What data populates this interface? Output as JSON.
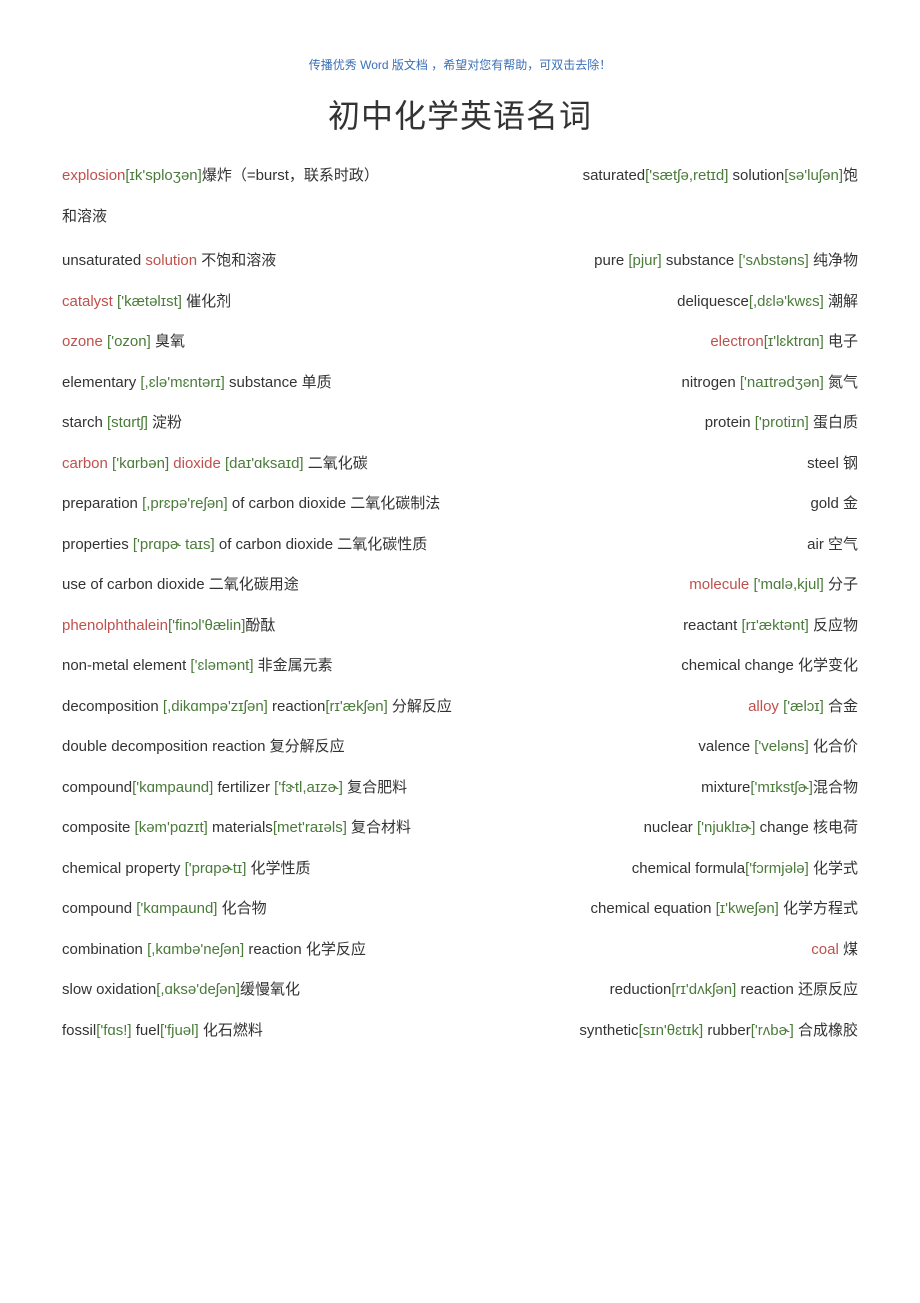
{
  "header_note": "传播优秀 Word 版文档 ，希望对您有帮助，可双击去除！",
  "title": "初中化学英语名词",
  "rows": [
    {
      "left": [
        {
          "t": "explosion",
          "c": "red"
        },
        {
          "t": "[ɪk'sploʒən]",
          "c": "grn"
        },
        {
          "t": "爆炸（=burst，联系时政）",
          "c": "blk"
        }
      ],
      "right": [
        {
          "t": "saturated",
          "c": "blk"
        },
        {
          "t": "['sætʃə,retɪd]",
          "c": "grn"
        },
        {
          "t": " solution",
          "c": "blk"
        },
        {
          "t": "[sə'luʃən]",
          "c": "grn"
        },
        {
          "t": "饱",
          "c": "blk"
        }
      ],
      "wrap": [
        {
          "t": "和溶液",
          "c": "blk"
        }
      ]
    },
    {
      "left": [
        {
          "t": "unsaturated ",
          "c": "blk"
        },
        {
          "t": "solution",
          "c": "red"
        },
        {
          "t": "  不饱和溶液",
          "c": "blk"
        }
      ],
      "right": [
        {
          "t": "pure ",
          "c": "blk"
        },
        {
          "t": "[pjur]",
          "c": "grn"
        },
        {
          "t": " substance ",
          "c": "blk"
        },
        {
          "t": "['sʌbstəns]",
          "c": "grn"
        },
        {
          "t": "  纯净物",
          "c": "blk"
        }
      ]
    },
    {
      "left": [
        {
          "t": "catalyst ",
          "c": "red"
        },
        {
          "t": "['kætəlɪst]",
          "c": "grn"
        },
        {
          "t": "  催化剂",
          "c": "blk"
        }
      ],
      "right": [
        {
          "t": "deliquesce",
          "c": "blk"
        },
        {
          "t": "[,dɛlə'kwɛs]",
          "c": "grn"
        },
        {
          "t": "    潮解",
          "c": "blk"
        }
      ]
    },
    {
      "left": [
        {
          "t": "ozone ",
          "c": "red"
        },
        {
          "t": "['ozon]",
          "c": "grn"
        },
        {
          "t": "  臭氧",
          "c": "blk"
        }
      ],
      "right": [
        {
          "t": "electron",
          "c": "red"
        },
        {
          "t": "[ɪ'lɛktrɑn]",
          "c": "grn"
        },
        {
          "t": "  电子",
          "c": "blk"
        }
      ]
    },
    {
      "left": [
        {
          "t": "elementary ",
          "c": "blk"
        },
        {
          "t": "[,ɛlə'mɛntərɪ]",
          "c": "grn"
        },
        {
          "t": " substance  单质",
          "c": "blk"
        }
      ],
      "right": [
        {
          "t": "nitrogen ",
          "c": "blk"
        },
        {
          "t": "['naɪtrədʒən]",
          "c": "grn"
        },
        {
          "t": "  氮气",
          "c": "blk"
        }
      ]
    },
    {
      "left": [
        {
          "t": "starch ",
          "c": "blk"
        },
        {
          "t": "[stɑrtʃ]",
          "c": "grn"
        },
        {
          "t": "  淀粉",
          "c": "blk"
        }
      ],
      "right": [
        {
          "t": "protein ",
          "c": "blk"
        },
        {
          "t": "['protiɪn]",
          "c": "grn"
        },
        {
          "t": "  蛋白质",
          "c": "blk"
        }
      ]
    },
    {
      "left": [
        {
          "t": "carbon ",
          "c": "red"
        },
        {
          "t": "['kɑrbən]",
          "c": "grn"
        },
        {
          "t": " dioxide ",
          "c": "red"
        },
        {
          "t": "[daɪ'ɑksaɪd]",
          "c": "grn"
        },
        {
          "t": "  二氧化碳",
          "c": "blk"
        }
      ],
      "right": [
        {
          "t": "steel  钢",
          "c": "blk"
        }
      ]
    },
    {
      "left": [
        {
          "t": "preparation ",
          "c": "blk"
        },
        {
          "t": "[,prɛpə'reʃən]",
          "c": "grn"
        },
        {
          "t": " of carbon dioxide  二氧化碳制法",
          "c": "blk"
        }
      ],
      "right": [
        {
          "t": "gold  金",
          "c": "blk"
        }
      ]
    },
    {
      "left": [
        {
          "t": "properties ",
          "c": "blk"
        },
        {
          "t": "['prɑpɚ taɪs]",
          "c": "grn"
        },
        {
          "t": " of carbon dioxide  二氧化碳性质",
          "c": "blk"
        }
      ],
      "right": [
        {
          "t": "air  空气",
          "c": "blk"
        }
      ]
    },
    {
      "left": [
        {
          "t": "use of carbon dioxide  二氧化碳用途",
          "c": "blk"
        }
      ],
      "right": [
        {
          "t": "molecule ",
          "c": "red"
        },
        {
          "t": "['mɑlə,kjul]",
          "c": "grn"
        },
        {
          "t": "  分子",
          "c": "blk"
        }
      ]
    },
    {
      "left": [
        {
          "t": "phenolphthalein",
          "c": "red"
        },
        {
          "t": "['finɔl'θælin]",
          "c": "grn"
        },
        {
          "t": "酚酞",
          "c": "blk"
        }
      ],
      "right": [
        {
          "t": "reactant ",
          "c": "blk"
        },
        {
          "t": "[rɪ'æktənt]",
          "c": "grn"
        },
        {
          "t": "  反应物",
          "c": "blk"
        }
      ]
    },
    {
      "left": [
        {
          "t": "non-metal element ",
          "c": "blk"
        },
        {
          "t": "['ɛləmənt]",
          "c": "grn"
        },
        {
          "t": "  非金属元素",
          "c": "blk"
        }
      ],
      "right": [
        {
          "t": "chemical change  化学变化",
          "c": "blk"
        }
      ]
    },
    {
      "left": [
        {
          "t": "decomposition ",
          "c": "blk"
        },
        {
          "t": "[,dikɑmpə'zɪʃən]",
          "c": "grn"
        },
        {
          "t": " reaction",
          "c": "blk"
        },
        {
          "t": "[rɪ'ækʃən]",
          "c": "grn"
        },
        {
          "t": "  分解反应",
          "c": "blk"
        }
      ],
      "right": [
        {
          "t": "alloy ",
          "c": "red"
        },
        {
          "t": "['ælɔɪ]",
          "c": "grn"
        },
        {
          "t": "  合金",
          "c": "blk"
        }
      ]
    },
    {
      "left": [
        {
          "t": "double decomposition reaction 复分解反应",
          "c": "blk"
        }
      ],
      "right": [
        {
          "t": "valence ",
          "c": "blk"
        },
        {
          "t": "['veləns]",
          "c": "grn"
        },
        {
          "t": "  化合价",
          "c": "blk"
        }
      ]
    },
    {
      "left": [
        {
          "t": "compound",
          "c": "blk"
        },
        {
          "t": "['kɑmpaund]",
          "c": "grn"
        },
        {
          "t": " fertilizer ",
          "c": "blk"
        },
        {
          "t": "['fɝtl,aɪzɚ]",
          "c": "grn"
        },
        {
          "t": "  复合肥料",
          "c": "blk"
        }
      ],
      "right": [
        {
          "t": "mixture",
          "c": "blk"
        },
        {
          "t": "['mɪkstʃɚ]",
          "c": "grn"
        },
        {
          "t": "混合物",
          "c": "blk"
        }
      ]
    },
    {
      "left": [
        {
          "t": "composite ",
          "c": "blk"
        },
        {
          "t": "[kəm'pɑzɪt]",
          "c": "grn"
        },
        {
          "t": " materials",
          "c": "blk"
        },
        {
          "t": "[met'raɪəls]",
          "c": "grn"
        },
        {
          "t": "  复合材料",
          "c": "blk"
        }
      ],
      "right": [
        {
          "t": "nuclear ",
          "c": "blk"
        },
        {
          "t": "['njuklɪɚ]",
          "c": "grn"
        },
        {
          "t": " change  核电荷",
          "c": "blk"
        }
      ]
    },
    {
      "left": [
        {
          "t": "chemical property ",
          "c": "blk"
        },
        {
          "t": "['prɑpɚtɪ]",
          "c": "grn"
        },
        {
          "t": "  化学性质",
          "c": "blk"
        }
      ],
      "right": [
        {
          "t": "chemical formula",
          "c": "blk"
        },
        {
          "t": "['fɔrmjələ]",
          "c": "grn"
        },
        {
          "t": "  化学式",
          "c": "blk"
        }
      ]
    },
    {
      "left": [
        {
          "t": "compound ",
          "c": "blk"
        },
        {
          "t": "['kɑmpaund]",
          "c": "grn"
        },
        {
          "t": "  化合物",
          "c": "blk"
        }
      ],
      "right": [
        {
          "t": "chemical equation ",
          "c": "blk"
        },
        {
          "t": "[ɪ'kweʃən]",
          "c": "grn"
        },
        {
          "t": "  化学方程式",
          "c": "blk"
        }
      ]
    },
    {
      "left": [
        {
          "t": "combination ",
          "c": "blk"
        },
        {
          "t": "[,kɑmbə'neʃən]",
          "c": "grn"
        },
        {
          "t": " reaction  化学反应",
          "c": "blk"
        }
      ],
      "right": [
        {
          "t": "coal ",
          "c": "red"
        },
        {
          "t": "煤",
          "c": "blk"
        }
      ]
    },
    {
      "left": [
        {
          "t": "slow oxidation",
          "c": "blk"
        },
        {
          "t": "[,ɑksə'deʃən]",
          "c": "grn"
        },
        {
          "t": "缓慢氧化",
          "c": "blk"
        }
      ],
      "right": [
        {
          "t": "reduction",
          "c": "blk"
        },
        {
          "t": "[rɪ'dʌkʃən]",
          "c": "grn"
        },
        {
          "t": " reaction  还原反应",
          "c": "blk"
        }
      ]
    },
    {
      "left": [
        {
          "t": "fossil",
          "c": "blk"
        },
        {
          "t": "['fɑs!]",
          "c": "grn"
        },
        {
          "t": " fuel",
          "c": "blk"
        },
        {
          "t": "['fjuəl]",
          "c": "grn"
        },
        {
          "t": "  化石燃料",
          "c": "blk"
        }
      ],
      "right": [
        {
          "t": "synthetic",
          "c": "blk"
        },
        {
          "t": "[sɪn'θɛtɪk]",
          "c": "grn"
        },
        {
          "t": " rubber",
          "c": "blk"
        },
        {
          "t": "['rʌbɚ]",
          "c": "grn"
        },
        {
          "t": "  合成橡胶",
          "c": "blk"
        }
      ]
    }
  ]
}
